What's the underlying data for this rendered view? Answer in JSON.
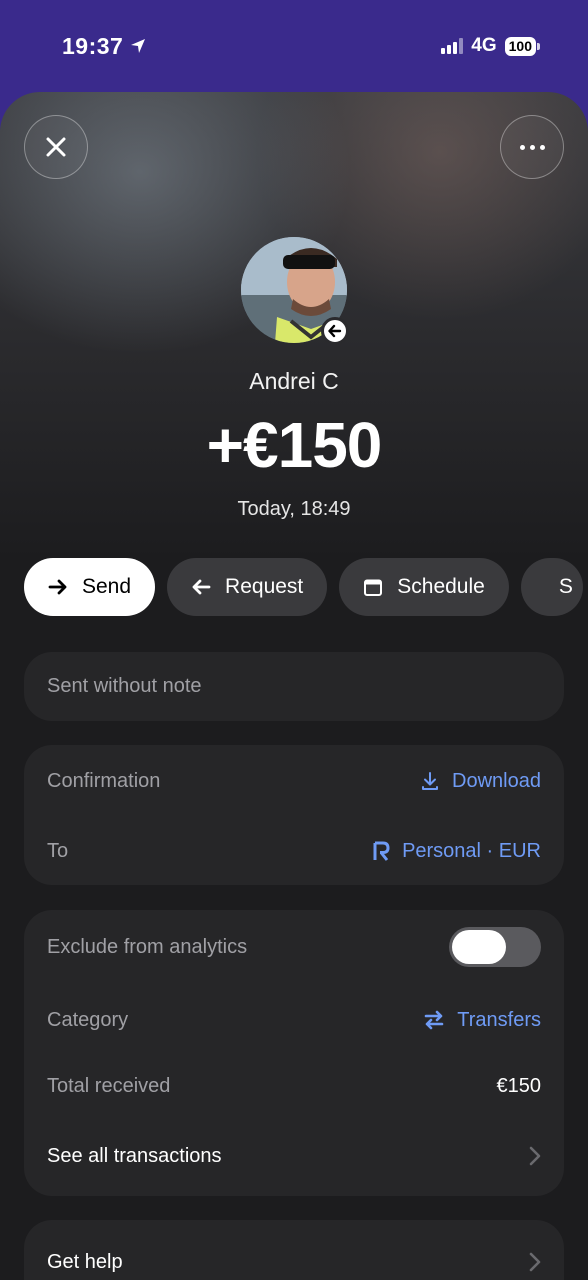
{
  "status": {
    "time": "19:37",
    "network": "4G",
    "battery": "100"
  },
  "header": {
    "close_icon": "close-icon",
    "more_icon": "more-dots-icon"
  },
  "transaction": {
    "name": "Andrei C",
    "amount": "+€150",
    "datetime": "Today, 18:49",
    "direction_icon": "arrow-left-icon"
  },
  "actions": [
    {
      "label": "Send",
      "icon": "arrow-right-icon"
    },
    {
      "label": "Request",
      "icon": "arrow-left-icon"
    },
    {
      "label": "Schedule",
      "icon": "calendar-icon"
    },
    {
      "label": "S",
      "icon": "refresh-icon"
    }
  ],
  "note": {
    "text": "Sent without note"
  },
  "details": {
    "confirmation_label": "Confirmation",
    "download_label": "Download",
    "to_label": "To",
    "to_value": "Personal · EUR"
  },
  "analytics": {
    "exclude_label": "Exclude from analytics",
    "exclude_on": false,
    "category_label": "Category",
    "category_value": "Transfers",
    "total_label": "Total received",
    "total_value": "€150",
    "see_all_label": "See all transactions"
  },
  "help": {
    "label": "Get help"
  },
  "colors": {
    "status_bg": "#3a2a8c",
    "accent": "#6f9bf5",
    "card": "#262628"
  }
}
